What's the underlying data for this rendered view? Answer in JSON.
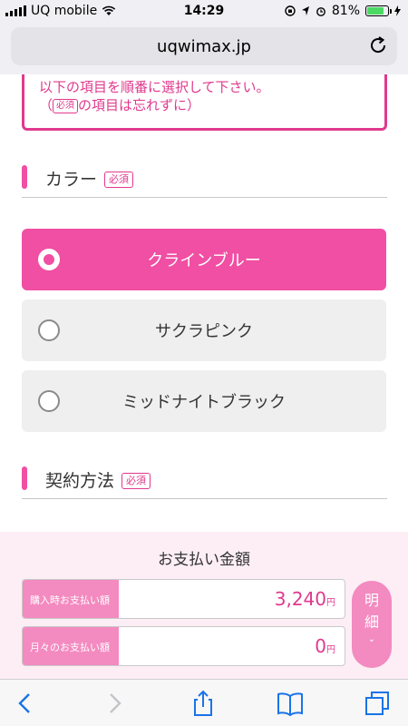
{
  "status_bar": {
    "carrier": "UQ mobile",
    "time": "14:29",
    "battery": "81%",
    "battery_level": 0.81
  },
  "browser": {
    "url": "uqwimax.jp"
  },
  "notice": {
    "line1": "以下の項目を順番に選択して下さい。",
    "line2_open": "（",
    "badge": "必須",
    "line2_rest": "の項目は忘れずに）"
  },
  "color_section": {
    "title": "カラー",
    "badge": "必須"
  },
  "color_options": [
    {
      "label": "クラインブルー",
      "selected": true
    },
    {
      "label": "サクラピンク",
      "selected": false
    },
    {
      "label": "ミッドナイトブラック",
      "selected": false
    }
  ],
  "contract_section": {
    "title": "契約方法",
    "badge": "必須"
  },
  "payment": {
    "title": "お支払い金額",
    "purchase_label": "購入時お支払い額",
    "purchase_value": "3,240",
    "purchase_unit": "円",
    "monthly_label": "月々のお支払い額",
    "monthly_value": "0",
    "monthly_unit": "円",
    "detail_char1": "明",
    "detail_char2": "細",
    "detail_chevron": "⌄"
  },
  "colors": {
    "accent": "#f04fa3",
    "accent_text": "#e0398d",
    "panel_bg": "#fdeef5"
  },
  "toolbar": {
    "icons": [
      "back-icon",
      "forward-icon",
      "share-icon",
      "bookmarks-icon",
      "tabs-icon"
    ]
  }
}
